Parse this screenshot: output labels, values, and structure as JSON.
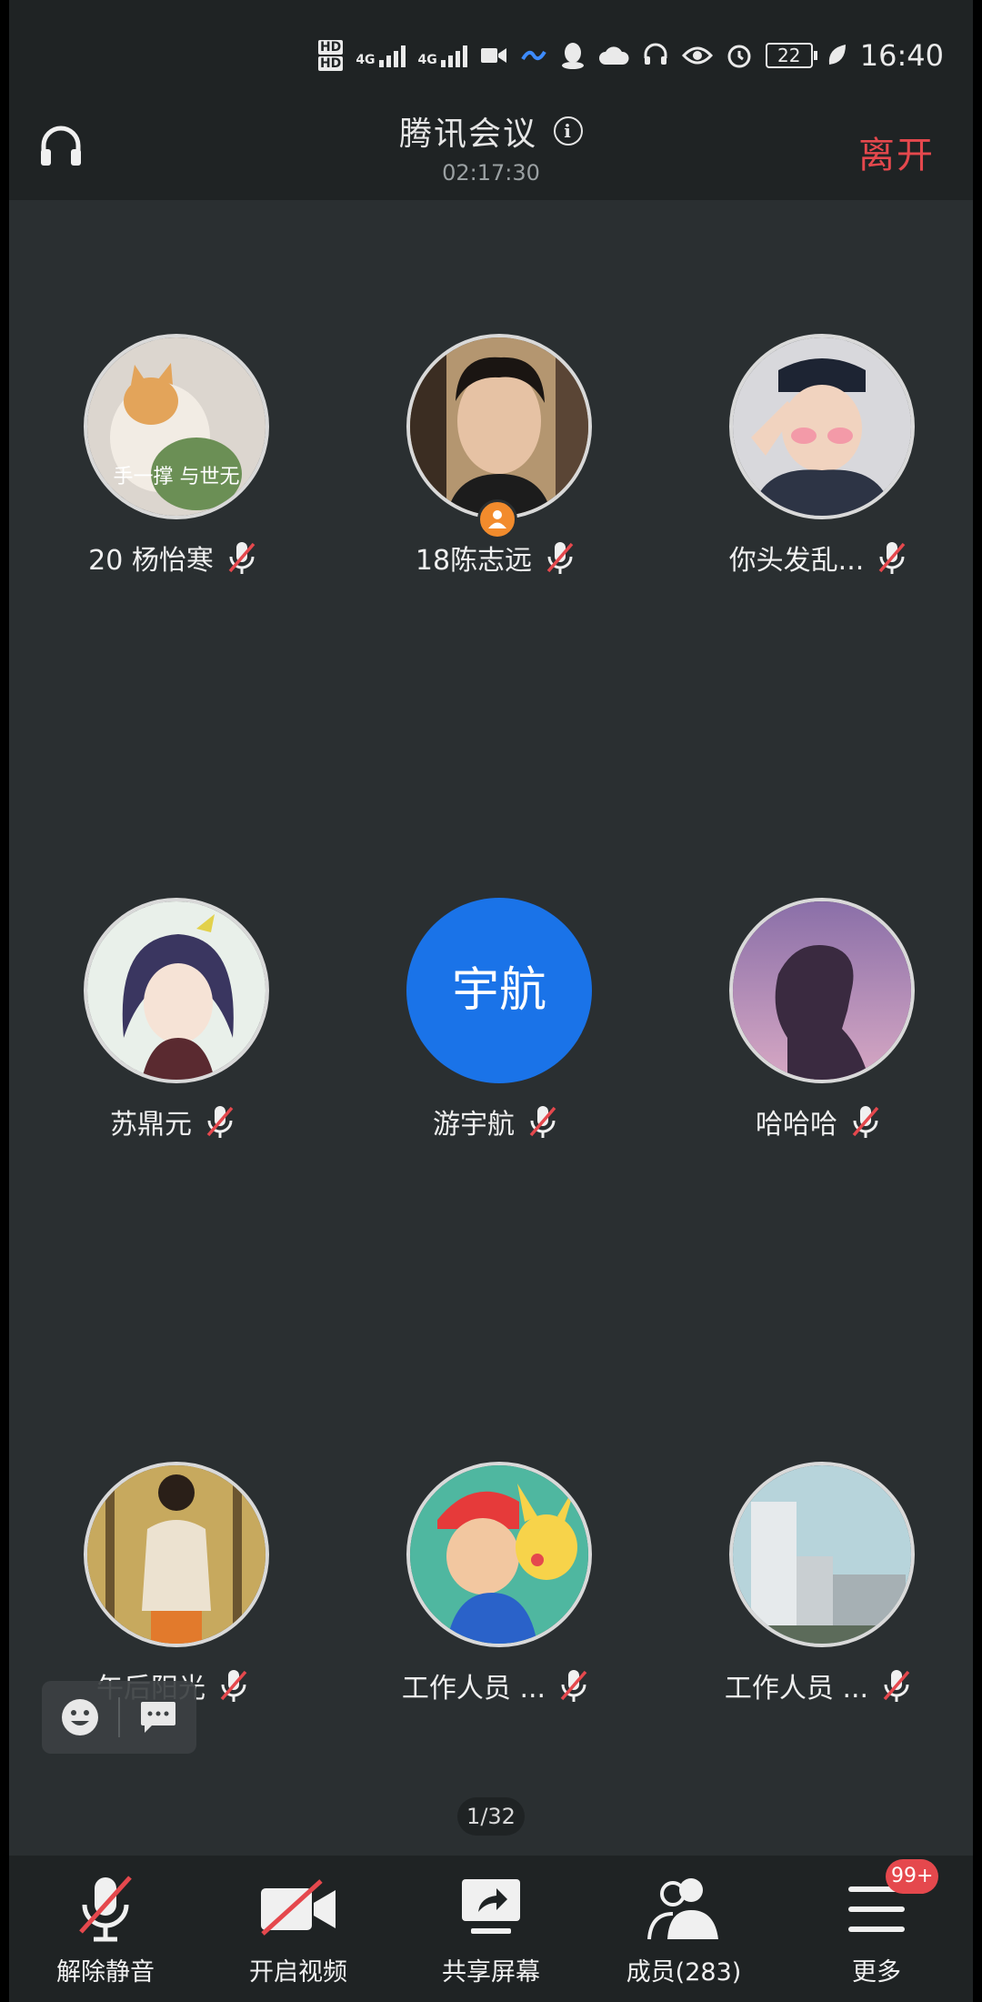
{
  "status_bar": {
    "hd1": "HD",
    "hd2": "HD",
    "net1": "4G",
    "net2": "4G",
    "battery": "22",
    "time": "16:40"
  },
  "header": {
    "title": "腾讯会议",
    "timer": "02:17:30",
    "leave": "离开"
  },
  "participants": [
    {
      "name": "20 杨怡寒",
      "initials": "",
      "muted": true
    },
    {
      "name": "18陈志远",
      "initials": "",
      "muted": true,
      "host": true
    },
    {
      "name": "你头发乱...",
      "initials": "",
      "muted": true
    },
    {
      "name": "苏鼎元",
      "initials": "",
      "muted": true
    },
    {
      "name": "游宇航",
      "initials": "宇航",
      "muted": true
    },
    {
      "name": "哈哈哈",
      "initials": "",
      "muted": true
    },
    {
      "name": "午后阳光",
      "initials": "",
      "muted": true
    },
    {
      "name": "工作人员 ...",
      "initials": "",
      "muted": true
    },
    {
      "name": "工作人员 ...",
      "initials": "",
      "muted": true
    }
  ],
  "avatar_text": {
    "cat_caption": "手一撑 与世无"
  },
  "pager": "1/32",
  "toolbar": {
    "unmute": "解除静音",
    "video": "开启视频",
    "share": "共享屏幕",
    "members": "成员(283)",
    "more": "更多",
    "more_badge": "99+"
  },
  "colors": {
    "background": "#2a2f31",
    "bar": "#1f2324",
    "accent_red": "#e5484d",
    "avatar_blue": "#1a73e8",
    "host_orange": "#f28b2c"
  }
}
